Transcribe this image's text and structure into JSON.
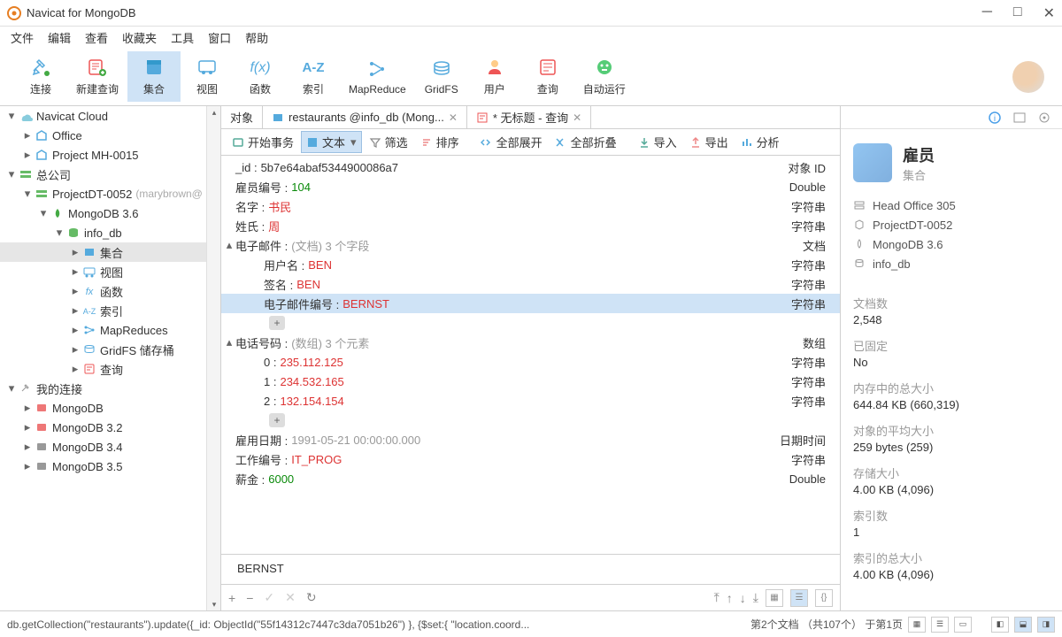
{
  "titlebar": {
    "title": "Navicat for MongoDB"
  },
  "menubar": [
    "文件",
    "编辑",
    "查看",
    "收藏夹",
    "工具",
    "窗口",
    "帮助"
  ],
  "toolbar": [
    {
      "label": "连接",
      "icon": "connect"
    },
    {
      "label": "新建查询",
      "icon": "newquery"
    },
    {
      "label": "集合",
      "icon": "collection",
      "active": true
    },
    {
      "label": "视图",
      "icon": "view"
    },
    {
      "label": "函数",
      "icon": "function"
    },
    {
      "label": "索引",
      "icon": "index"
    },
    {
      "label": "MapReduce",
      "icon": "mapreduce"
    },
    {
      "label": "GridFS",
      "icon": "gridfs"
    },
    {
      "label": "用户",
      "icon": "user"
    },
    {
      "label": "查询",
      "icon": "query"
    },
    {
      "label": "自动运行",
      "icon": "autorun"
    }
  ],
  "tree": [
    {
      "indent": 0,
      "exp": "▾",
      "icon": "cloud",
      "label": "Navicat Cloud"
    },
    {
      "indent": 1,
      "exp": "▸",
      "icon": "office",
      "label": "Office"
    },
    {
      "indent": 1,
      "exp": "▸",
      "icon": "office",
      "label": "Project MH-0015"
    },
    {
      "indent": 0,
      "exp": "▾",
      "icon": "server",
      "label": "总公司"
    },
    {
      "indent": 1,
      "exp": "▾",
      "icon": "server",
      "label": "ProjectDT-0052",
      "suffix": "(marybrown@"
    },
    {
      "indent": 2,
      "exp": "▾",
      "icon": "mongo",
      "label": "MongoDB 3.6"
    },
    {
      "indent": 3,
      "exp": "▾",
      "icon": "db",
      "label": "info_db"
    },
    {
      "indent": 4,
      "exp": "▸",
      "icon": "coll",
      "label": "集合",
      "selected": true
    },
    {
      "indent": 4,
      "exp": "▸",
      "icon": "viewi",
      "label": "视图"
    },
    {
      "indent": 4,
      "exp": "▸",
      "icon": "fxi",
      "label": "函数"
    },
    {
      "indent": 4,
      "exp": "▸",
      "icon": "azi",
      "label": "索引"
    },
    {
      "indent": 4,
      "exp": "▸",
      "icon": "mri",
      "label": "MapReduces"
    },
    {
      "indent": 4,
      "exp": "▸",
      "icon": "gfsi",
      "label": "GridFS 储存桶"
    },
    {
      "indent": 4,
      "exp": "▸",
      "icon": "qryi",
      "label": "查询"
    },
    {
      "indent": 0,
      "exp": "▾",
      "icon": "myconn",
      "label": "我的连接"
    },
    {
      "indent": 1,
      "exp": "▸",
      "icon": "mongoc",
      "label": "MongoDB"
    },
    {
      "indent": 1,
      "exp": "▸",
      "icon": "mongoc",
      "label": "MongoDB 3.2"
    },
    {
      "indent": 1,
      "exp": "▸",
      "icon": "mongod",
      "label": "MongoDB 3.4"
    },
    {
      "indent": 1,
      "exp": "▸",
      "icon": "mongod",
      "label": "MongoDB 3.5"
    }
  ],
  "tabs": [
    {
      "label": "对象",
      "icon": "",
      "closable": false
    },
    {
      "label": "restaurants @info_db (Mong...",
      "icon": "table",
      "closable": true
    },
    {
      "label": "* 无标题 - 查询",
      "icon": "query",
      "closable": true
    }
  ],
  "subtoolbar": {
    "start_trans": "开始事务",
    "text": "文本",
    "filter": "筛选",
    "sort": "排序",
    "expand_all": "全部展开",
    "collapse_all": "全部折叠",
    "import": "导入",
    "export": "导出",
    "analyze": "分析"
  },
  "doc": [
    {
      "indent": 0,
      "exp": "",
      "key": "_id :",
      "val": "5b7e64abaf5344900086a7",
      "vclass": "",
      "type": "对象 ID"
    },
    {
      "indent": 0,
      "exp": "",
      "key": "雇员编号 :",
      "val": "104",
      "vclass": "green",
      "type": "Double"
    },
    {
      "indent": 0,
      "exp": "",
      "key": "名字 :",
      "val": "书民",
      "vclass": "red",
      "type": "字符串"
    },
    {
      "indent": 0,
      "exp": "",
      "key": "姓氏 :",
      "val": "周",
      "vclass": "red",
      "type": "字符串"
    },
    {
      "indent": 0,
      "exp": "▴",
      "key": "电子邮件 :",
      "val": "(文档) 3 个字段",
      "vclass": "gray",
      "type": "文档"
    },
    {
      "indent": 1,
      "exp": "",
      "key": "用户名 :",
      "val": "BEN",
      "vclass": "red",
      "type": "字符串"
    },
    {
      "indent": 1,
      "exp": "",
      "key": "签名 :",
      "val": "BEN",
      "vclass": "red",
      "type": "字符串"
    },
    {
      "indent": 1,
      "exp": "",
      "key": "电子邮件编号 :",
      "val": "BERNST",
      "vclass": "red",
      "type": "字符串",
      "selected": true
    },
    {
      "indent": 1,
      "exp": "",
      "key": "",
      "val": "",
      "vclass": "",
      "type": "",
      "plus": true
    },
    {
      "indent": 0,
      "exp": "▴",
      "key": "电话号码 :",
      "val": "(数组) 3 个元素",
      "vclass": "gray",
      "type": "数组"
    },
    {
      "indent": 1,
      "exp": "",
      "key": "0 :",
      "val": "235.112.125",
      "vclass": "red",
      "type": "字符串"
    },
    {
      "indent": 1,
      "exp": "",
      "key": "1 :",
      "val": "234.532.165",
      "vclass": "red",
      "type": "字符串"
    },
    {
      "indent": 1,
      "exp": "",
      "key": "2 :",
      "val": "132.154.154",
      "vclass": "red",
      "type": "字符串"
    },
    {
      "indent": 1,
      "exp": "",
      "key": "",
      "val": "",
      "vclass": "",
      "type": "",
      "plus": true
    },
    {
      "indent": 0,
      "exp": "",
      "key": "雇用日期 :",
      "val": "1991-05-21 00:00:00.000",
      "vclass": "gray",
      "type": "日期时间"
    },
    {
      "indent": 0,
      "exp": "",
      "key": "工作编号 :",
      "val": "IT_PROG",
      "vclass": "red",
      "type": "字符串"
    },
    {
      "indent": 0,
      "exp": "",
      "key": "薪金 :",
      "val": "6000",
      "vclass": "green",
      "type": "Double"
    }
  ],
  "preview": "BERNST",
  "rpanel": {
    "title": "雇员",
    "subtitle": "集合",
    "path": [
      "Head Office 305",
      "ProjectDT-0052",
      "MongoDB 3.6",
      "info_db"
    ],
    "stats": [
      {
        "label": "文档数",
        "value": "2,548"
      },
      {
        "label": "已固定",
        "value": "No"
      },
      {
        "label": "内存中的总大小",
        "value": "644.84 KB (660,319)"
      },
      {
        "label": "对象的平均大小",
        "value": "259 bytes (259)"
      },
      {
        "label": "存储大小",
        "value": "4.00 KB (4,096)"
      },
      {
        "label": "索引数",
        "value": "1"
      },
      {
        "label": "索引的总大小",
        "value": "4.00 KB (4,096)"
      }
    ]
  },
  "statusbar": {
    "left": "db.getCollection(\"restaurants\").update({_id: ObjectId(\"55f14312c7447c3da7051b26\") }, {$set:{ \"location.coord...",
    "right": "第2个文档 （共107个） 于第1页"
  }
}
